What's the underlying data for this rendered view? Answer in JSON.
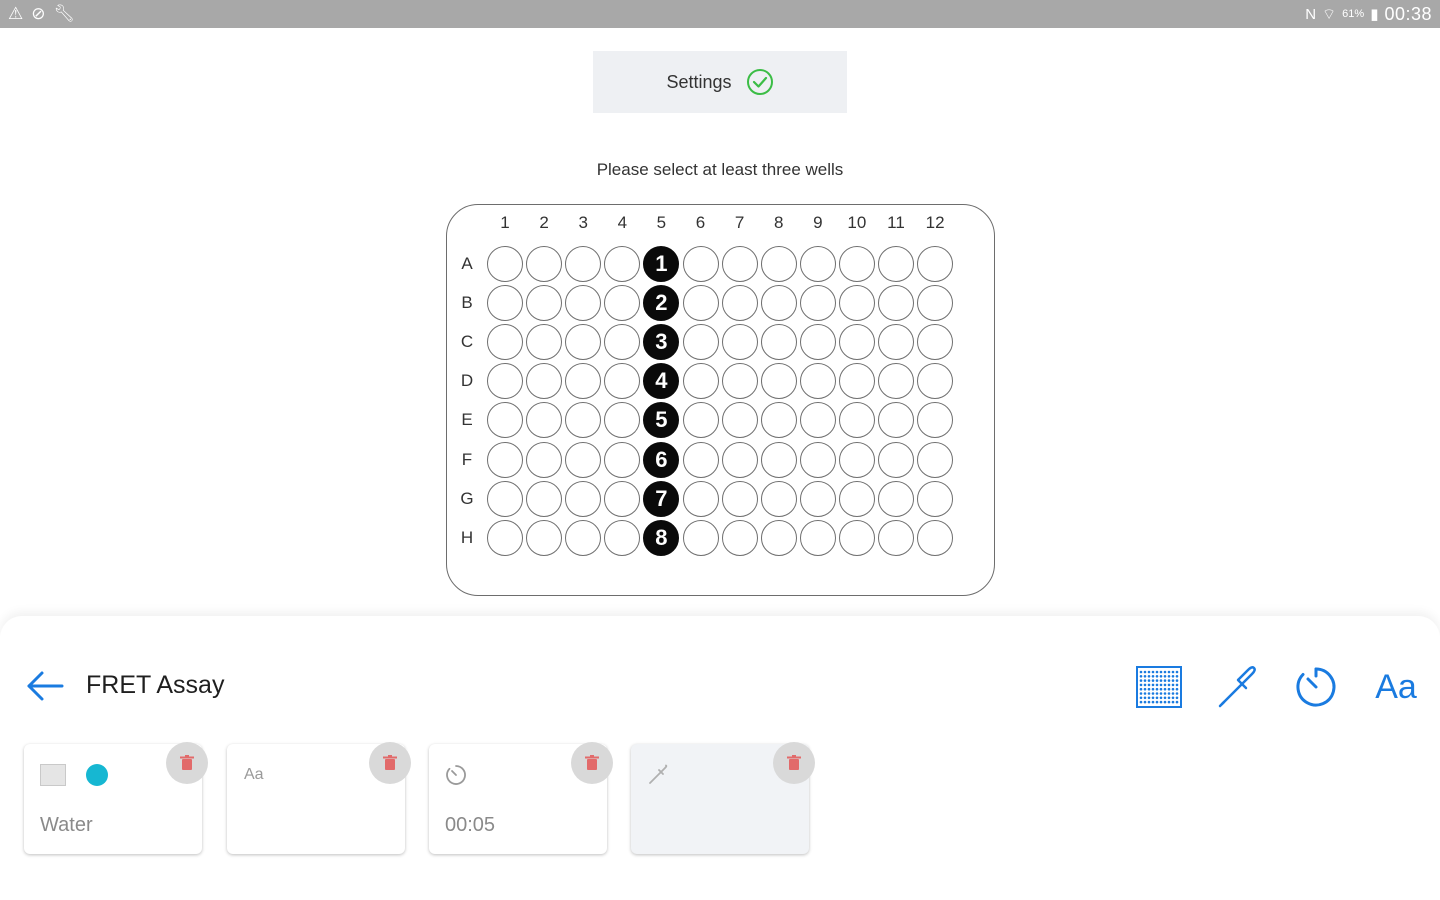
{
  "status_bar": {
    "left_icons": [
      "warning-icon",
      "compass-icon",
      "wrench-icon"
    ],
    "right_icons": [
      "nfc-icon",
      "wifi-icon",
      "battery-icon"
    ],
    "battery_pct": "61%",
    "time": "00:38"
  },
  "settings": {
    "label": "Settings",
    "status_icon": "check-circle-icon",
    "check_color": "#3bbd45"
  },
  "instruction": "Please select at least three wells",
  "plate": {
    "columns": [
      "1",
      "2",
      "3",
      "4",
      "5",
      "6",
      "7",
      "8",
      "9",
      "10",
      "11",
      "12"
    ],
    "rows": [
      "A",
      "B",
      "C",
      "D",
      "E",
      "F",
      "G",
      "H"
    ],
    "selected_wells": [
      {
        "row": "A",
        "col": "5",
        "order": "1"
      },
      {
        "row": "B",
        "col": "5",
        "order": "2"
      },
      {
        "row": "C",
        "col": "5",
        "order": "3"
      },
      {
        "row": "D",
        "col": "5",
        "order": "4"
      },
      {
        "row": "E",
        "col": "5",
        "order": "5"
      },
      {
        "row": "F",
        "col": "5",
        "order": "6"
      },
      {
        "row": "G",
        "col": "5",
        "order": "7"
      },
      {
        "row": "H",
        "col": "5",
        "order": "8"
      }
    ]
  },
  "assay": {
    "title": "FRET Assay",
    "accent_color": "#1a7be0"
  },
  "toolbar": {
    "grid_icon": "plate-grid-icon",
    "pipette_icon": "pipette-icon",
    "timer_icon": "timer-icon",
    "text_label": "Aa"
  },
  "steps": [
    {
      "icon": "plate-grid-icon",
      "value": "Water",
      "color": "#16b7d2"
    },
    {
      "icon": "text-icon",
      "icon_label": "Aa",
      "value": ""
    },
    {
      "icon": "timer-icon",
      "value": "00:05"
    },
    {
      "icon": "pipette-icon",
      "value": ""
    }
  ],
  "delete_icon_color": "#e26a6a"
}
